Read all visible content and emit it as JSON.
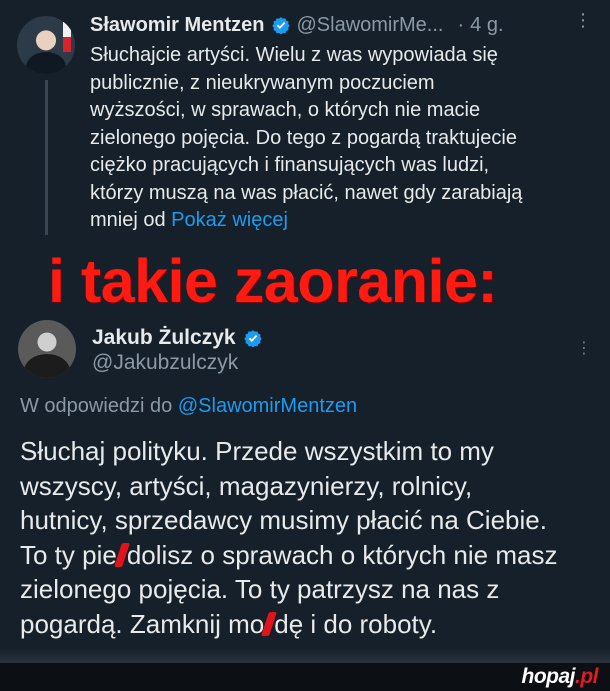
{
  "tweet1": {
    "author_name": "Sławomir Mentzen",
    "handle": "@SlawomirMe...",
    "separator": "·",
    "time": "4 g.",
    "more_icon": "more-vertical-icon",
    "body_lines": [
      "Słuchajcie artyści. Wielu z was wypowiada się",
      "publicznie, z nieukrywanym poczuciem",
      "wyższości, w sprawach, o których nie macie",
      "zielonego pojęcia. Do tego z pogardą traktujecie",
      "ciężko pracujących i finansujących was ludzi,",
      "którzy muszą na was płacić, nawet gdy zarabiają"
    ],
    "body_last_line": "mniej od",
    "show_more": "Pokaż więcej"
  },
  "caption": "i takie zaoranie:",
  "tweet2": {
    "author_name": "Jakub Żulczyk",
    "handle": "@Jakubzulczyk",
    "reply_prefix": "W odpowiedzi do",
    "reply_mention": "@SlawomirMentzen",
    "line1": "Słuchaj polityku. Przede wszystkim to my",
    "line2": "wszyscy, artyści, magazynierzy, rolnicy,",
    "line3": "hutnicy, sprzedawcy musimy płacić na Ciebie.",
    "line4a": "To ty pie",
    "line4b": "dolisz o sprawach o których nie masz",
    "line5": "zielonego pojęcia. To ty patrzysz na nas z",
    "line6a": "pogardą. Zamknij mo",
    "line6b": "dę i do roboty."
  },
  "watermark": {
    "name": "hopaj",
    "tld": ".pl"
  },
  "colors": {
    "background": "#15202b",
    "link": "#1d9bf0",
    "caption": "#ff1a12",
    "secondary_text": "#8b98a5"
  }
}
